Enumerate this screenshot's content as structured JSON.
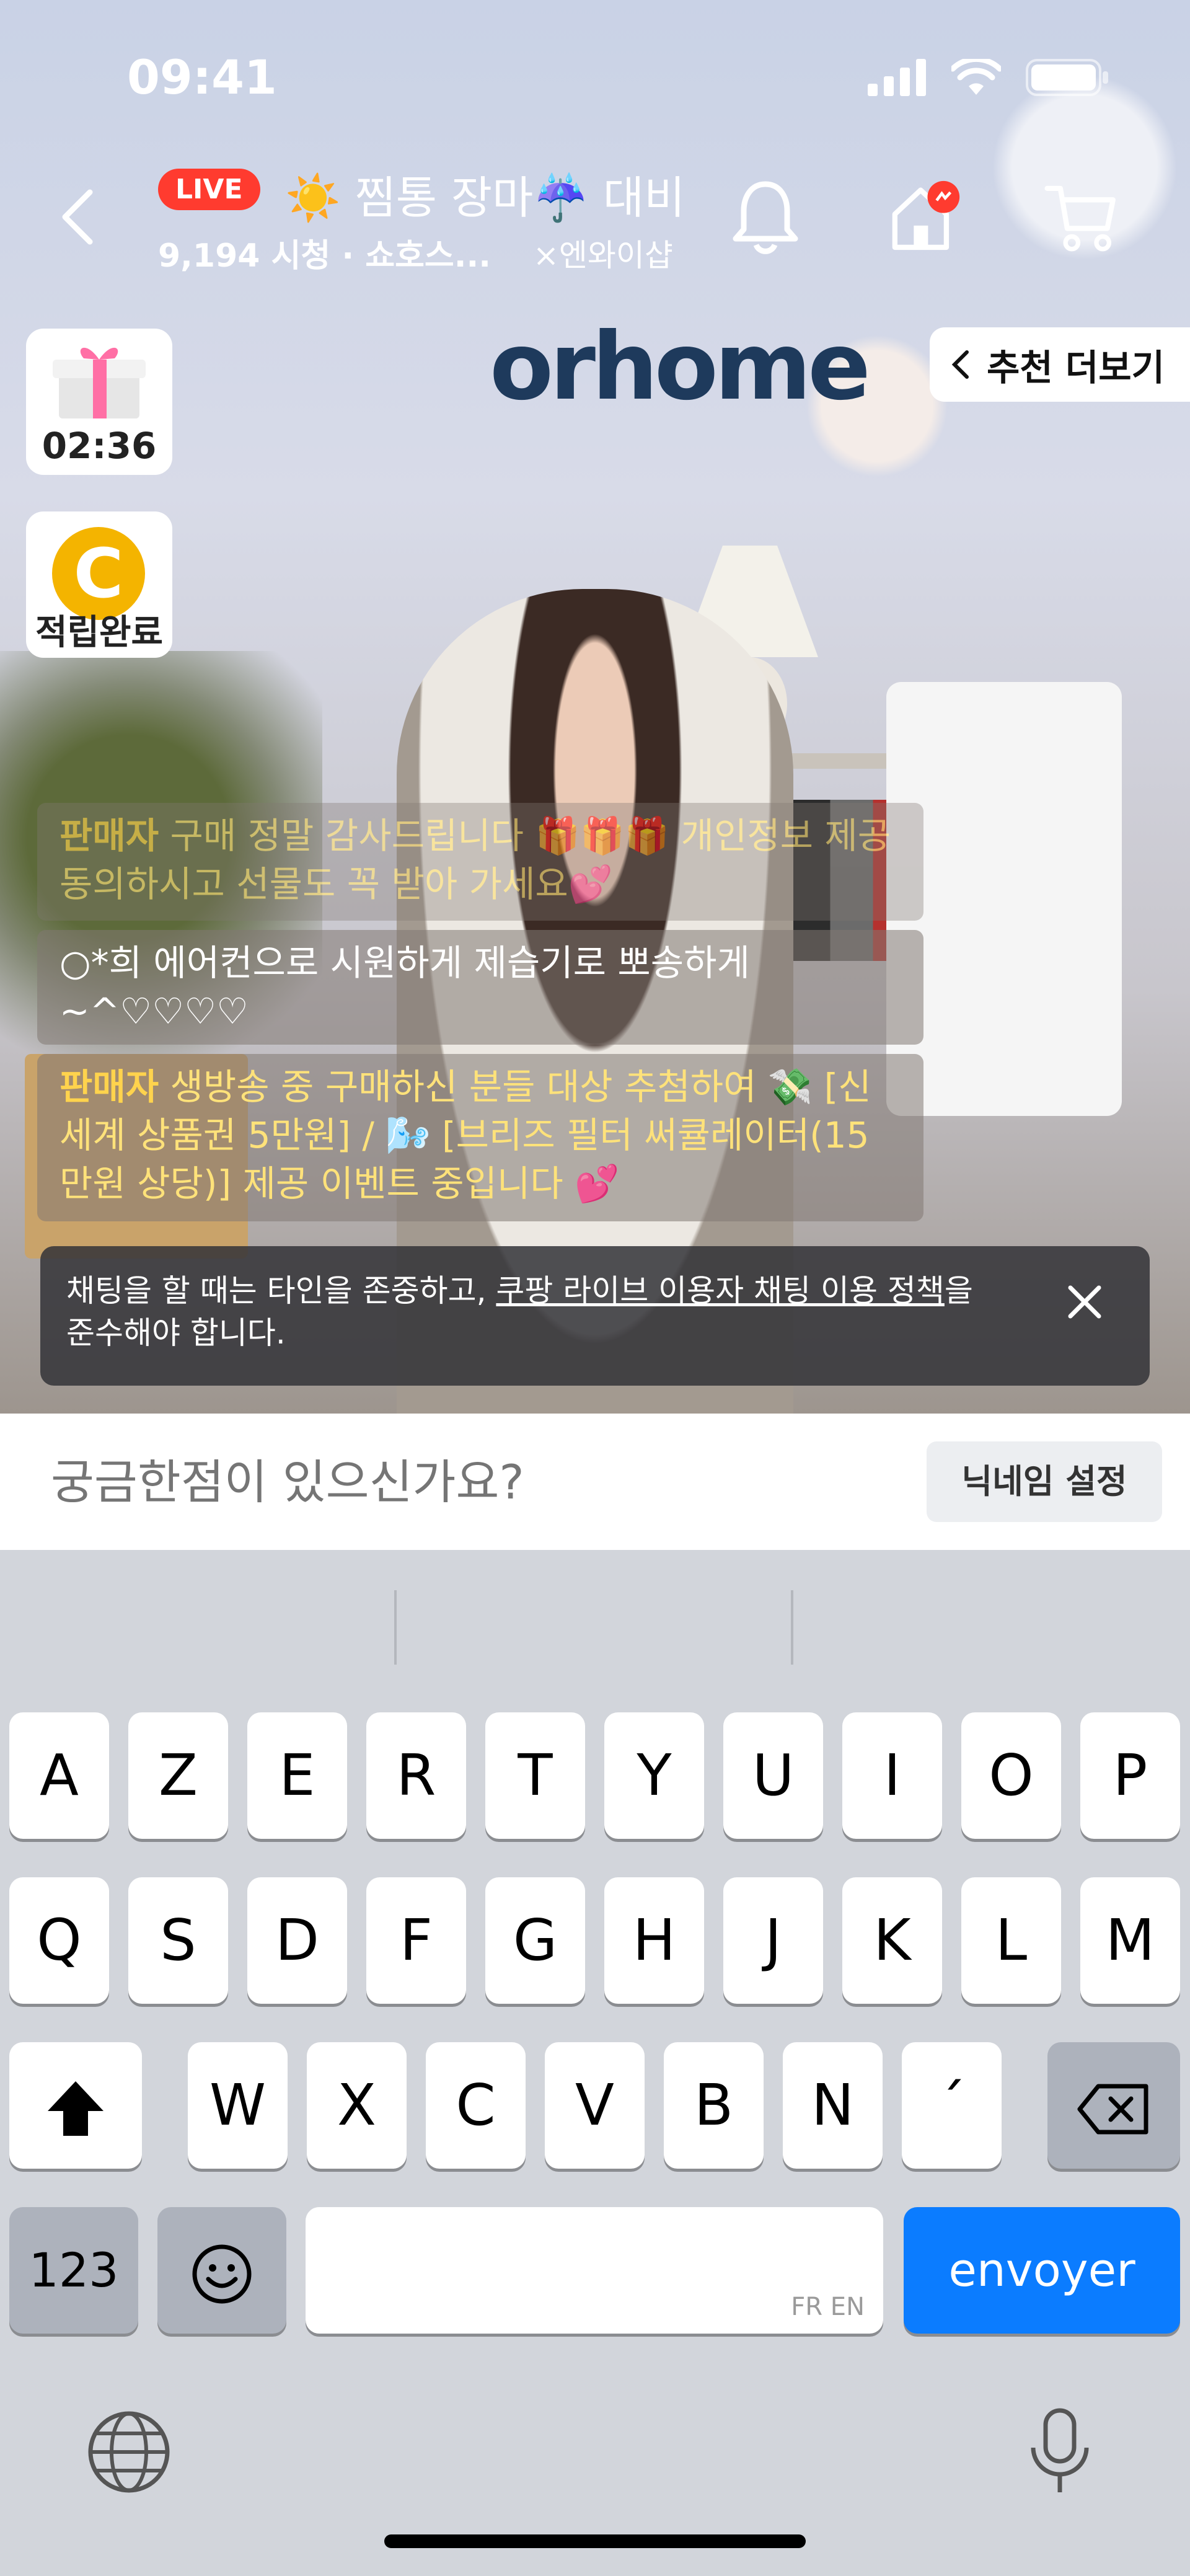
{
  "status_bar": {
    "time": "09:41"
  },
  "header": {
    "live_badge": "LIVE",
    "title": "☀️ 찜통 장마☔️ 대비",
    "viewers": "9,194 시청 · 쇼호스...",
    "collab": "×엔와이샵"
  },
  "brand_logo": "orhome",
  "recommend_button": "추천 더보기",
  "gift_timer": "02:36",
  "point_label": "적립완료",
  "point_coin": "C",
  "chat_messages": [
    {
      "author": "판매자",
      "text": "구매 정말 감사드립니다 🎁🎁🎁 개인정보 제공 동의하시고 선물도 꼭 받아 가세요💕"
    },
    {
      "author": "",
      "text": "○*희 에어컨으로 시원하게 제습기로 뽀송하게~^♡♡♡♡"
    },
    {
      "author": "판매자",
      "text": "생방송 중 구매하신 분들 대상 추첨하여 💸 [신세계 상품권 5만원] / 🌬️ [브리즈 필터 써큘레이터(15만원 상당)] 제공 이벤트 중입니다 💕"
    }
  ],
  "notice": {
    "prefix": "채팅을 할 때는 타인을 존중하고, ",
    "link": "쿠팡 라이브 이용자 채팅 이용 정책",
    "suffix": "을 준수해야 합니다."
  },
  "chat_input": {
    "placeholder": "궁금한점이 있으신가요?"
  },
  "nickname_button": "닉네임 설정",
  "keyboard": {
    "row1": [
      "A",
      "Z",
      "E",
      "R",
      "T",
      "Y",
      "U",
      "I",
      "O",
      "P"
    ],
    "row2": [
      "Q",
      "S",
      "D",
      "F",
      "G",
      "H",
      "J",
      "K",
      "L",
      "M"
    ],
    "row3": [
      "W",
      "X",
      "C",
      "V",
      "B",
      "N",
      "´"
    ],
    "numbers_key": "123",
    "space_lang": "FR EN",
    "send_key": "envoyer"
  },
  "colors": {
    "live": "#ff3b2f",
    "send": "#0b7cff",
    "seller": "#ffd34d"
  }
}
